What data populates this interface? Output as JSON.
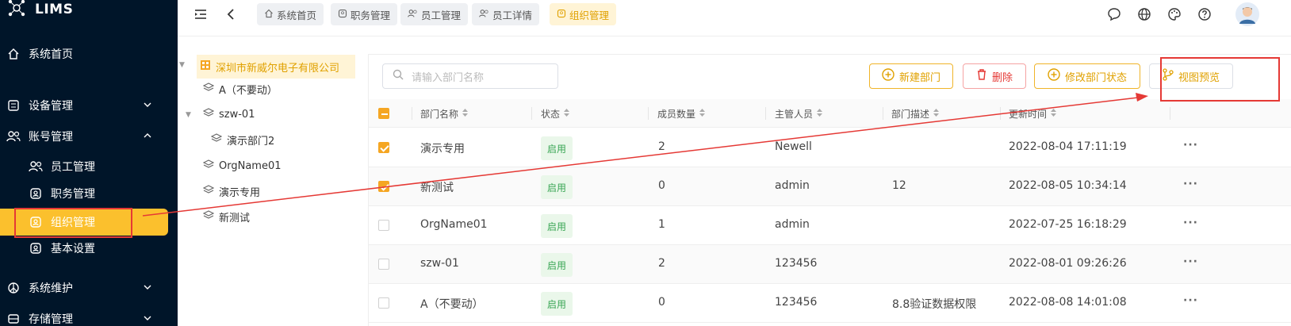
{
  "app": {
    "title": "LIMS"
  },
  "sidebar": {
    "items": [
      {
        "label": "系统首页",
        "icon": "home-icon"
      },
      {
        "label": "设备管理",
        "icon": "device-icon",
        "expand": "down"
      },
      {
        "label": "账号管理",
        "icon": "users-icon",
        "expand": "up"
      },
      {
        "label": "员工管理",
        "icon": "users-icon"
      },
      {
        "label": "职务管理",
        "icon": "badge-icon"
      },
      {
        "label": "组织管理",
        "icon": "badge-icon",
        "active": true
      },
      {
        "label": "基本设置",
        "icon": "badge-icon"
      },
      {
        "label": "系统维护",
        "icon": "peace-icon",
        "expand": "down"
      },
      {
        "label": "存储管理",
        "icon": "storage-icon",
        "expand": "down"
      }
    ]
  },
  "tabs": [
    {
      "label": "系统首页"
    },
    {
      "label": "职务管理"
    },
    {
      "label": "员工管理"
    },
    {
      "label": "员工详情"
    },
    {
      "label": "组织管理",
      "active": true
    }
  ],
  "tree": {
    "root": "深圳市新威尔电子有限公司",
    "nodes": [
      "A（不要动）",
      "szw-01",
      "演示部门2",
      "OrgName01",
      "演示专用",
      "新测试"
    ]
  },
  "toolbar": {
    "search_placeholder": "请输入部门名称",
    "new_label": "新建部门",
    "delete_label": "删除",
    "status_label": "修改部门状态",
    "preview_label": "视图预览"
  },
  "table": {
    "columns": [
      "部门名称",
      "状态",
      "成员数量",
      "主管人员",
      "部门描述",
      "更新时间"
    ],
    "rows": [
      {
        "checked": true,
        "name": "演示专用",
        "status": "启用",
        "count": "2",
        "manager": "Newell",
        "desc": "",
        "time": "2022-08-04 17:11:19"
      },
      {
        "checked": true,
        "name": "新测试",
        "status": "启用",
        "count": "0",
        "manager": "admin",
        "desc": "12",
        "time": "2022-08-05 10:34:14"
      },
      {
        "checked": false,
        "name": "OrgName01",
        "status": "启用",
        "count": "1",
        "manager": "admin",
        "desc": "",
        "time": "2022-07-25 16:18:29"
      },
      {
        "checked": false,
        "name": "szw-01",
        "status": "启用",
        "count": "2",
        "manager": "123456",
        "desc": "",
        "time": "2022-08-01 09:26:26"
      },
      {
        "checked": false,
        "name": "A（不要动）",
        "status": "启用",
        "count": "0",
        "manager": "123456",
        "desc": "8.8验证数据权限",
        "time": "2022-08-08 14:01:08"
      }
    ],
    "more_label": "···"
  },
  "colors": {
    "sidebar_bg": "#001529",
    "accent": "#fbc02d",
    "annotation": "#e53935"
  }
}
